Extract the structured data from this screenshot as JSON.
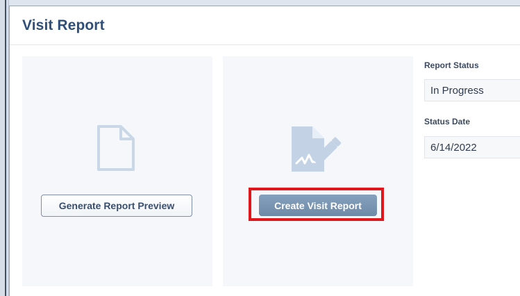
{
  "panel": {
    "title": "Visit Report"
  },
  "preview_card": {
    "icon": "document-icon",
    "button_label": "Generate Report Preview"
  },
  "create_card": {
    "icon": "signed-document-icon",
    "button_label": "Create Visit Report",
    "highlight_color": "#e0161d"
  },
  "fields": {
    "report_status": {
      "label": "Report Status",
      "value": "In Progress"
    },
    "status_date": {
      "label": "Status Date",
      "value": "6/14/2022"
    }
  },
  "colors": {
    "title": "#2f4f7a",
    "primary_button": "#7893b1",
    "card_background": "#f5f7fa"
  }
}
